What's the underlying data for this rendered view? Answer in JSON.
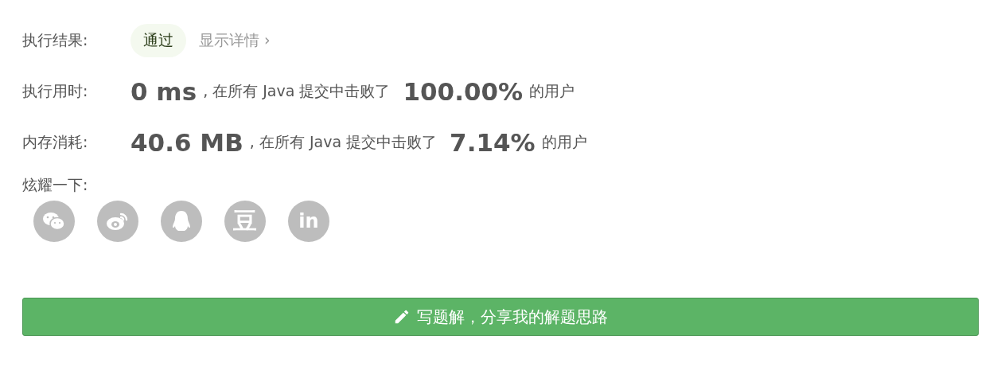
{
  "result": {
    "label": "执行结果:",
    "status": "通过",
    "details_link": "显示详情",
    "details_caret": "›"
  },
  "stats": [
    {
      "label": "执行用时:",
      "value": "0 ms",
      "text_before": ", 在所有 Java 提交中击败了",
      "percent": "100.00%",
      "text_after": "的用户"
    },
    {
      "label": "内存消耗:",
      "value": "40.6 MB",
      "text_before": ", 在所有 Java 提交中击败了",
      "percent": "7.14%",
      "text_after": "的用户"
    }
  ],
  "share": {
    "label": "炫耀一下:",
    "items": [
      {
        "kind": "wechat"
      },
      {
        "kind": "weibo"
      },
      {
        "kind": "qq"
      },
      {
        "kind": "glyph",
        "text": "豆"
      },
      {
        "kind": "glyph",
        "text": "in"
      }
    ]
  },
  "solution_button": {
    "label": "写题解，分享我的解题思路"
  }
}
